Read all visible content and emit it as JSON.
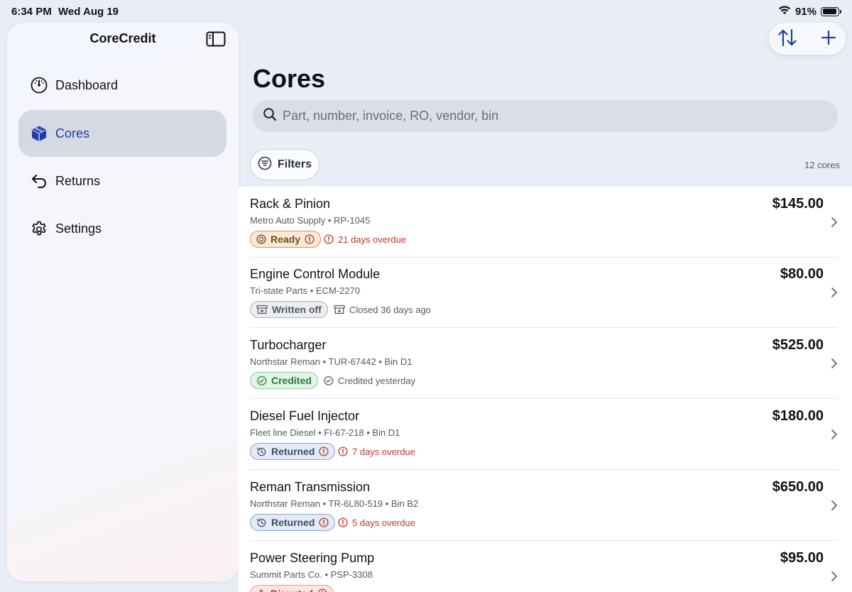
{
  "status_bar": {
    "time": "6:34 PM",
    "date": "Wed Aug 19",
    "battery": "91%",
    "battery_level": 0.91
  },
  "sidebar": {
    "title": "CoreCredit",
    "items": [
      {
        "label": "Dashboard",
        "icon": "gauge-icon",
        "active": false
      },
      {
        "label": "Cores",
        "icon": "cube-icon",
        "active": true
      },
      {
        "label": "Returns",
        "icon": "return-arrow-icon",
        "active": false
      },
      {
        "label": "Settings",
        "icon": "gear-icon",
        "active": false
      }
    ]
  },
  "toolbar": {
    "sort_icon": "sort-icon",
    "add_icon": "plus-icon"
  },
  "main": {
    "title": "Cores",
    "search": {
      "placeholder": "Part, number, invoice, RO, vendor, bin",
      "value": ""
    },
    "filters_label": "Filters",
    "count_label": "12 cores"
  },
  "cores": [
    {
      "name": "Rack & Pinion",
      "subtitle": "Metro Auto Supply • RP-1045",
      "price": "$145.00",
      "status": "Ready",
      "status_type": "ready",
      "alert": true,
      "meta": "21 days overdue",
      "meta_type": "overdue"
    },
    {
      "name": "Engine Control Module",
      "subtitle": "Tri-state Parts • ECM-2270",
      "price": "$80.00",
      "status": "Written off",
      "status_type": "writtenoff",
      "alert": false,
      "meta": "Closed 36 days ago",
      "meta_type": "closed"
    },
    {
      "name": "Turbocharger",
      "subtitle": "Northstar Reman • TUR-67442 • Bin D1",
      "price": "$525.00",
      "status": "Credited",
      "status_type": "credited",
      "alert": false,
      "meta": "Credited yesterday",
      "meta_type": "credited"
    },
    {
      "name": "Diesel Fuel Injector",
      "subtitle": "Fleet line Diesel • FI-67-218 • Bin D1",
      "price": "$180.00",
      "status": "Returned",
      "status_type": "returned",
      "alert": true,
      "meta": "7 days overdue",
      "meta_type": "overdue"
    },
    {
      "name": "Reman Transmission",
      "subtitle": "Northstar Reman • TR-6L80-519 • Bin B2",
      "price": "$650.00",
      "status": "Returned",
      "status_type": "returned",
      "alert": true,
      "meta": "5 days overdue",
      "meta_type": "overdue"
    },
    {
      "name": "Power Steering Pump",
      "subtitle": "Summit Parts Co. • PSP-3308",
      "price": "$95.00",
      "status": "Disputed",
      "status_type": "disputed",
      "alert": true,
      "meta": "",
      "meta_type": "overdue"
    }
  ],
  "colors": {
    "accent": "#1d3fa6",
    "overdue": "#c0392b",
    "credited": "#2c7a3d",
    "ready": "#7a4a14"
  }
}
